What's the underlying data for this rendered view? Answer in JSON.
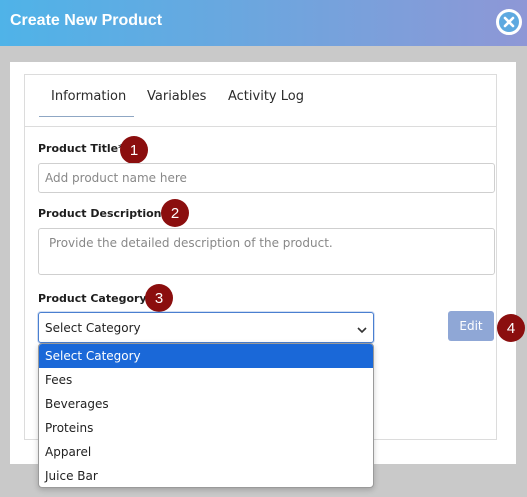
{
  "modal": {
    "title": "Create New Product",
    "close_icon": "close-icon"
  },
  "tabs": [
    {
      "label": "Information",
      "active": true
    },
    {
      "label": "Variables",
      "active": false
    },
    {
      "label": "Activity Log",
      "active": false
    }
  ],
  "form": {
    "title_label": "Product Title*",
    "title_placeholder": "Add product name here",
    "description_label": "Product Description*",
    "description_placeholder": "Provide the detailed description of the product.",
    "category_label": "Product Category",
    "category_selected": "Select Category",
    "edit_label": "Edit"
  },
  "badges": [
    "1",
    "2",
    "3",
    "4"
  ],
  "category_options": [
    "Select Category",
    "Fees",
    "Beverages",
    "Proteins",
    "Apparel",
    "Juice Bar"
  ],
  "colors": {
    "header_start": "#4fb3e8",
    "header_end": "#8e97d6",
    "badge": "#8b0e0e",
    "edit_button": "#8fa7d6",
    "option_selected": "#1a68d8"
  }
}
